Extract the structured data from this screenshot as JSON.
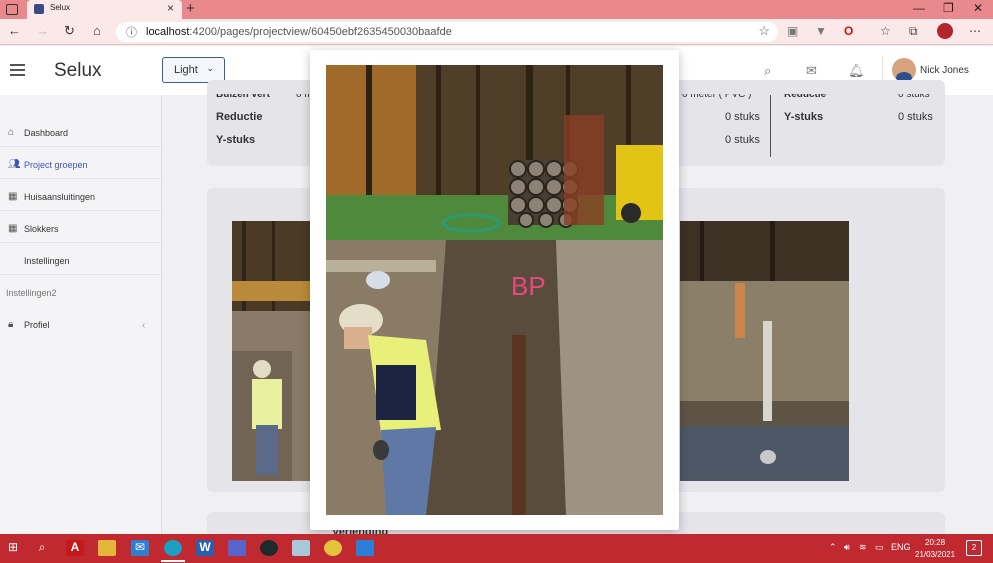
{
  "browser": {
    "tab_title": "Selux",
    "url_host": "localhost",
    "url_path": ":4200/pages/projectview/60450ebf2635450030baafde",
    "window_controls": [
      "minimize-icon",
      "maximize-icon",
      "close-icon"
    ]
  },
  "appbar": {
    "brand": "Selux",
    "theme_label": "Light",
    "user_name": "Nick Jones",
    "icons": [
      "search-icon",
      "mail-icon",
      "bell-icon"
    ]
  },
  "sidebar": {
    "items": [
      {
        "label": "Dashboard",
        "icon": "home-icon"
      },
      {
        "label": "Project groepen",
        "icon": "users-icon",
        "active": true
      },
      {
        "label": "Huisaansluitingen",
        "icon": "table-icon"
      },
      {
        "label": "Slokkers",
        "icon": "table-icon"
      },
      {
        "label": "Instellingen",
        "icon": ""
      }
    ],
    "section_heading": "Instellingen2",
    "profile": {
      "label": "Profiel",
      "icon": "lock-icon"
    }
  },
  "materials": {
    "left": [
      {
        "label": "Buizen vert",
        "value": "0 m"
      },
      {
        "label": "Reductie",
        "value": ""
      },
      {
        "label": "Y-stuks",
        "value": ""
      }
    ],
    "middle": [
      {
        "label": "",
        "value": "0 meter ( PVC )"
      },
      {
        "label": "",
        "value": "0 stuks"
      },
      {
        "label": "",
        "value": "0 stuks"
      }
    ],
    "right": [
      {
        "label": "Reductie",
        "value": "0 stuks"
      },
      {
        "label": "Y-stuks",
        "value": "0 stuks"
      }
    ]
  },
  "bottom_card_partial": "Verlenging",
  "taskbar": {
    "language": "ENG",
    "time": "20:28",
    "date": "21/03/2021",
    "notifications": "2"
  },
  "colors": {
    "tabbar": "#e9898d",
    "taskbar": "#c0292f",
    "accent": "#3b57b0"
  }
}
